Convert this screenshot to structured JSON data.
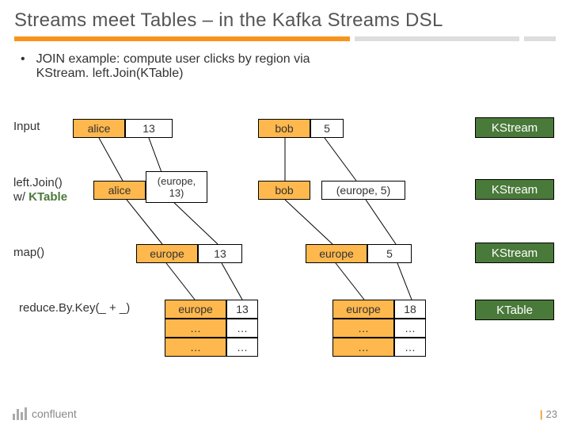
{
  "title": "Streams meet Tables – in the Kafka Streams DSL",
  "bullet": {
    "line1": "JOIN example: compute user clicks by region via",
    "line2": "KStream. left.Join(KTable)"
  },
  "rows": {
    "input": {
      "label": "Input",
      "left": [
        "alice",
        "13"
      ],
      "right": [
        "bob",
        "5"
      ],
      "badge": "KStream"
    },
    "leftjoin": {
      "label1": "left.Join()",
      "label2": "w/ ",
      "label2b": "KTable",
      "left": [
        "alice",
        "(europe, 13)"
      ],
      "right": [
        "bob",
        "(europe, 5)"
      ],
      "badge": "KStream"
    },
    "map": {
      "label": "map()",
      "left": [
        "europe",
        "13"
      ],
      "right": [
        "europe",
        "5"
      ],
      "badge": "KStream"
    },
    "reduce": {
      "label": "reduce.By.Key(_ + _)",
      "rows": [
        {
          "l": [
            "europe",
            "13"
          ],
          "r": [
            "europe",
            "18"
          ]
        },
        {
          "l": [
            "…",
            "…"
          ],
          "r": [
            "…",
            "…"
          ]
        },
        {
          "l": [
            "…",
            "…"
          ],
          "r": [
            "…",
            "…"
          ]
        }
      ],
      "badge": "KTable"
    }
  },
  "footer": {
    "brand": "confluent",
    "page": "23"
  }
}
